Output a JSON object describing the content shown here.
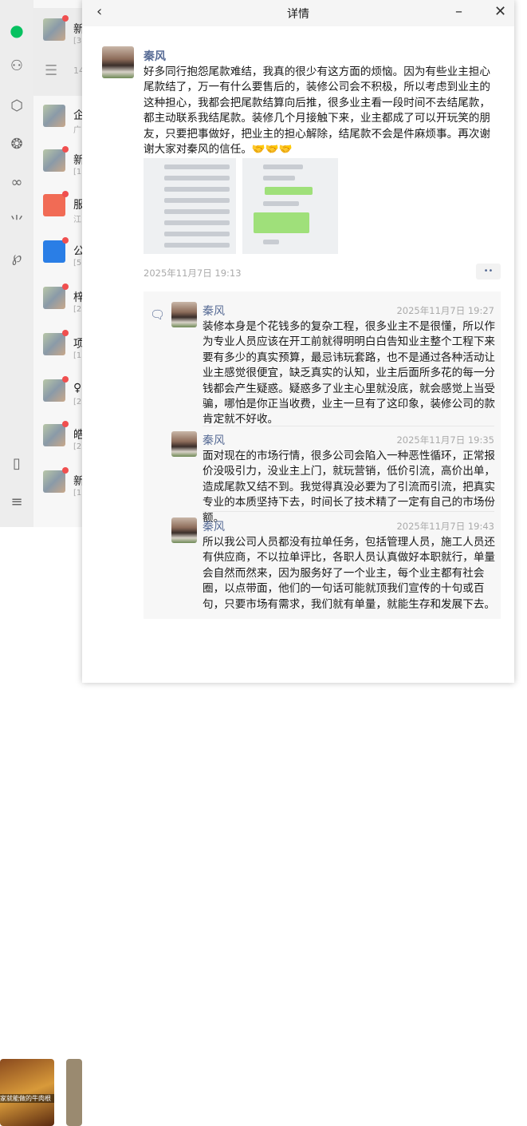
{
  "window": {
    "title": "详情",
    "back": "chevron-left-icon",
    "minimize": "minimize-icon",
    "close": "close-icon"
  },
  "sidebar": {
    "icons": [
      "chat-icon",
      "contacts-icon",
      "favorites-cube-icon",
      "moments-aperture-icon",
      "channels-butterfly-icon",
      "search-sparkle-icon",
      "mini-programs-icon",
      "phone-icon",
      "menu-icon"
    ],
    "accent": "#07c160"
  },
  "chat_list": {
    "items": [
      {
        "name": "新",
        "sub": "[3"
      },
      {
        "name": "",
        "sub": "14"
      },
      {
        "name": "企",
        "sub": "广"
      },
      {
        "name": "新",
        "sub": "[1"
      },
      {
        "name": "服",
        "sub": "江"
      },
      {
        "name": "公",
        "sub": "[5"
      },
      {
        "name": "梓",
        "sub": "[2"
      },
      {
        "name": "项",
        "sub": "[1"
      },
      {
        "name": "♀",
        "sub": "[2"
      },
      {
        "name": "皓",
        "sub": "[2"
      },
      {
        "name": "新",
        "sub": "[1"
      }
    ]
  },
  "background": {
    "video_caption": "家就能做的牛肉根"
  },
  "post": {
    "author": "秦风",
    "text": "好多同行抱怨尾款难结，我真的很少有这方面的烦恼。因为有些业主担心尾款结了，万一有什么要售后的，装修公司会不积极，所以考虑到业主的这种担心，我都会把尾款结算向后推，很多业主看一段时间不去结尾款，都主动联系我结尾款。装修几个月接触下来，业主都成了可以开玩笑的朋友，只要把事做好，把业主的担心解除，结尾款不会是件麻烦事。再次谢谢大家对秦风的信任。🤝🤝🤝",
    "timestamp": "2025年11月7日 19:13",
    "more_button": "••"
  },
  "comments": [
    {
      "author": "秦风",
      "time": "2025年11月7日 19:27",
      "text": "装修本身是个花钱多的复杂工程，很多业主不是很懂，所以作为专业人员应该在开工前就得明明白白告知业主整个工程下来要有多少的真实预算，最忌讳玩套路，也不是通过各种活动让业主感觉很便宜，缺乏真实的认知，业主后面所多花的每一分钱都会产生疑惑。疑惑多了业主心里就没底，就会感觉上当受骗，哪怕是你正当收费，业主一旦有了这印象，装修公司的款肯定就不好收。"
    },
    {
      "author": "秦风",
      "time": "2025年11月7日 19:35",
      "text": "面对现在的市场行情，很多公司会陷入一种恶性循环，正常报价没吸引力，没业主上门，就玩营销，低价引流，高价出单，造成尾款又结不到。我觉得真没必要为了引流而引流，把真实专业的本质坚持下去，时间长了技术精了一定有自己的市场份额。"
    },
    {
      "author": "秦风",
      "time": "2025年11月7日 19:43",
      "text": "所以我公司人员都没有拉单任务，包括管理人员，施工人员还有供应商，不以拉单评比，各职人员认真做好本职就行，单量会自然而然来，因为服务好了一个业主，每个业主都有社会圈，以点带面，他们的一句话可能就顶我们宣传的十句或百句，只要市场有需求，我们就有单量，就能生存和发展下去。"
    }
  ]
}
